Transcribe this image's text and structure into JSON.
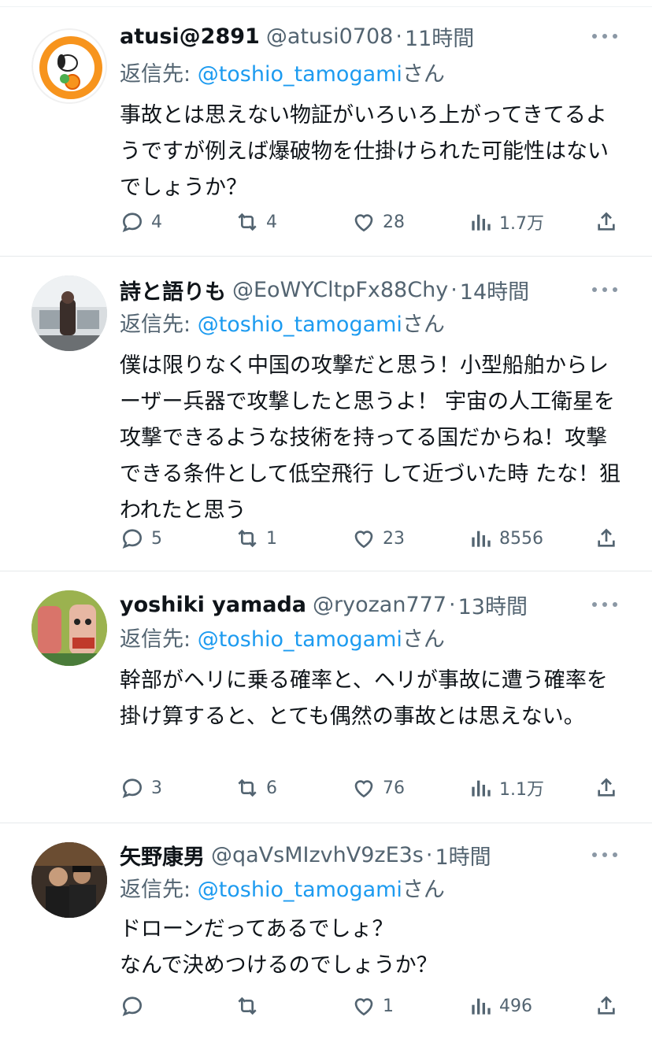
{
  "replying_to_prefix": "返信先: ",
  "replying_to_mention": "@toshio_tamogami",
  "replying_to_suffix": "さん",
  "tweets": [
    {
      "name": "atusi@2891",
      "handle": "@atusi0708",
      "time": "11時間",
      "text": "事故とは思えない物証がいろいろ上がってきてるようですが例えば爆破物を仕掛けられた可能性はないでしょうか？",
      "replies": "4",
      "retweets": "4",
      "likes": "28",
      "views": "1.7万"
    },
    {
      "name": "詩と語りも",
      "handle": "@EoWYCltpFx88Chy",
      "time": "14時間",
      "text": "僕は限りなく中国の攻撃だと思う！小型船舶からレーザー兵器で攻撃したと思うよ！ 宇宙の人工衛星を攻撃できるような技術を持ってる国だからね！攻撃できる条件として低空飛行 して近づいた時 たな！狙われたと思う",
      "replies": "5",
      "retweets": "1",
      "likes": "23",
      "views": "8556"
    },
    {
      "name": "yoshiki yamada",
      "handle": "@ryozan777",
      "time": "13時間",
      "text": "幹部がヘリに乗る確率と、ヘリが事故に遭う確率を掛け算すると、とても偶然の事故とは思えない。",
      "replies": "3",
      "retweets": "6",
      "likes": "76",
      "views": "1.1万"
    },
    {
      "name": "矢野康男",
      "handle": "@qaVsMIzvhV9zE3s",
      "time": "1時間",
      "text": "ドローンだってあるでしょ？\nなんで決めつけるのでしょうか？",
      "replies": "",
      "retweets": "",
      "likes": "1",
      "views": "496"
    }
  ],
  "colors": {
    "accent": "#1d9bf0",
    "muted": "#536471",
    "text": "#0f1419"
  },
  "icons": [
    "reply-icon",
    "retweet-icon",
    "like-icon",
    "views-icon",
    "share-icon",
    "more-icon"
  ]
}
